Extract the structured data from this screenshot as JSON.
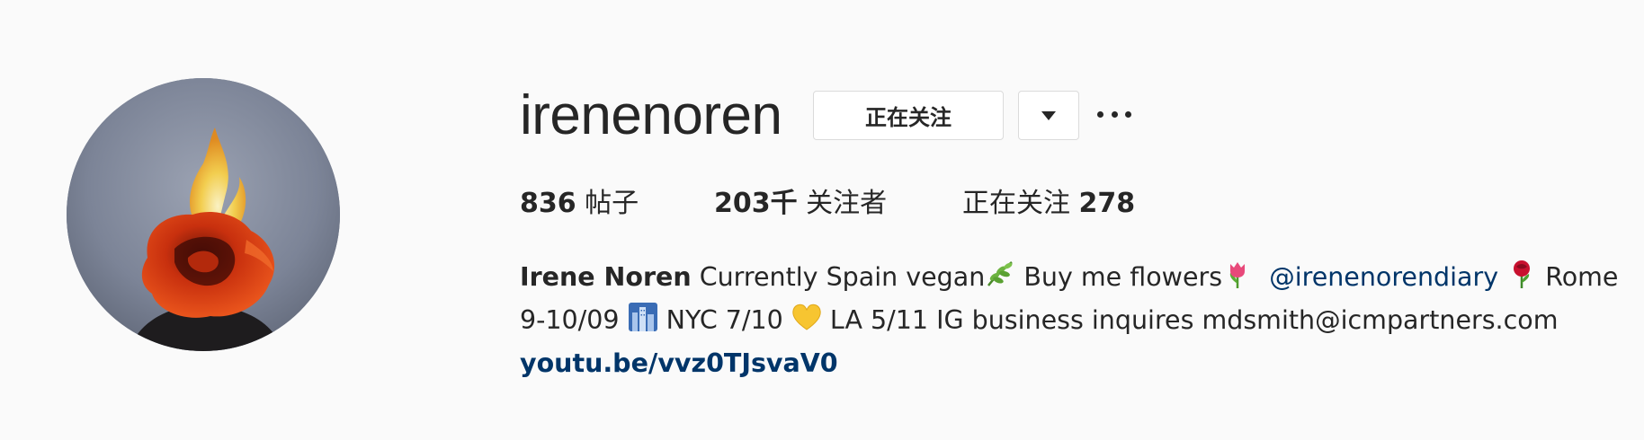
{
  "profile": {
    "username": "irenenoren",
    "follow_button_label": "正在关注",
    "stats": {
      "posts_count": "836",
      "posts_label": "帖子",
      "followers_count": "203千",
      "followers_label": "关注者",
      "following_label": "正在关注",
      "following_count": "278"
    },
    "bio": {
      "full_name": "Irene Noren",
      "text_1": " Currently Spain vegan",
      "text_2": " Buy me flowers",
      "mention": "@irenenorendiary",
      "text_3": " Rome 9-10/09 ",
      "text_4": " NYC 7/10 ",
      "text_5": " LA 5/11 IG business inquires mdsmith@icmpartners.com",
      "link": "youtu.be/vvz0TJsvaV0"
    }
  },
  "icons": {
    "avatar": "burning-rose-avatar",
    "dropdown": "caret-down-icon",
    "more": "more-options-icon",
    "emoji_1": "herb-emoji",
    "emoji_2": "tulip-emoji",
    "emoji_3": "rose-emoji",
    "emoji_4": "cityscape-emoji",
    "emoji_5": "yellow-heart-emoji"
  },
  "colors": {
    "link": "#003569",
    "text": "#262626",
    "background": "#fafafa",
    "button_border": "#dbdbdb"
  }
}
